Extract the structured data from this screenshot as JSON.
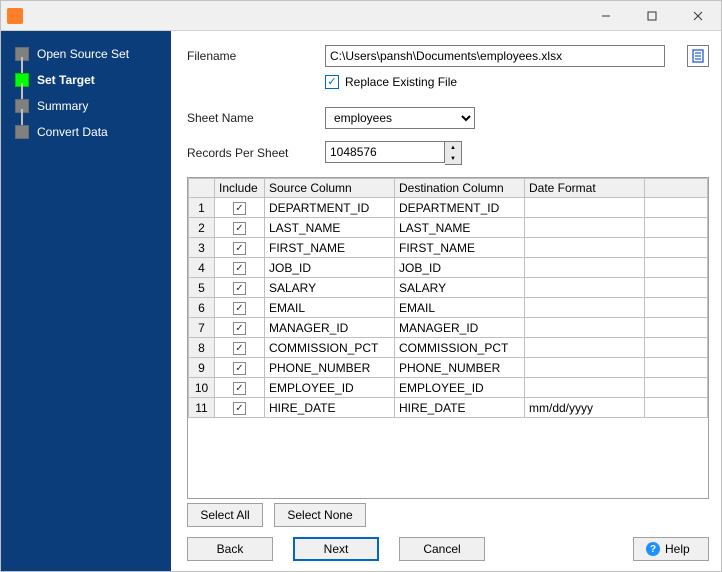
{
  "sidebar": {
    "items": [
      {
        "label": "Open Source Set",
        "active": false
      },
      {
        "label": "Set Target",
        "active": true
      },
      {
        "label": "Summary",
        "active": false
      },
      {
        "label": "Convert Data",
        "active": false
      }
    ]
  },
  "form": {
    "filename_label": "Filename",
    "filename_value": "C:\\Users\\pansh\\Documents\\employees.xlsx",
    "replace_label": "Replace Existing File",
    "replace_checked": true,
    "sheet_label": "Sheet Name",
    "sheet_value": "employees",
    "records_label": "Records Per Sheet",
    "records_value": "1048576"
  },
  "grid": {
    "headers": {
      "include": "Include",
      "source": "Source Column",
      "dest": "Destination Column",
      "fmt": "Date Format"
    },
    "rows": [
      {
        "n": "1",
        "include": true,
        "src": "DEPARTMENT_ID",
        "dst": "DEPARTMENT_ID",
        "fmt": ""
      },
      {
        "n": "2",
        "include": true,
        "src": "LAST_NAME",
        "dst": "LAST_NAME",
        "fmt": ""
      },
      {
        "n": "3",
        "include": true,
        "src": "FIRST_NAME",
        "dst": "FIRST_NAME",
        "fmt": ""
      },
      {
        "n": "4",
        "include": true,
        "src": "JOB_ID",
        "dst": "JOB_ID",
        "fmt": ""
      },
      {
        "n": "5",
        "include": true,
        "src": "SALARY",
        "dst": "SALARY",
        "fmt": ""
      },
      {
        "n": "6",
        "include": true,
        "src": "EMAIL",
        "dst": "EMAIL",
        "fmt": ""
      },
      {
        "n": "7",
        "include": true,
        "src": "MANAGER_ID",
        "dst": "MANAGER_ID",
        "fmt": ""
      },
      {
        "n": "8",
        "include": true,
        "src": "COMMISSION_PCT",
        "dst": "COMMISSION_PCT",
        "fmt": ""
      },
      {
        "n": "9",
        "include": true,
        "src": "PHONE_NUMBER",
        "dst": "PHONE_NUMBER",
        "fmt": ""
      },
      {
        "n": "10",
        "include": true,
        "src": "EMPLOYEE_ID",
        "dst": "EMPLOYEE_ID",
        "fmt": ""
      },
      {
        "n": "11",
        "include": true,
        "src": "HIRE_DATE",
        "dst": "HIRE_DATE",
        "fmt": "mm/dd/yyyy"
      }
    ]
  },
  "buttons": {
    "select_all": "Select All",
    "select_none": "Select None",
    "back": "Back",
    "next": "Next",
    "cancel": "Cancel",
    "help": "Help"
  }
}
